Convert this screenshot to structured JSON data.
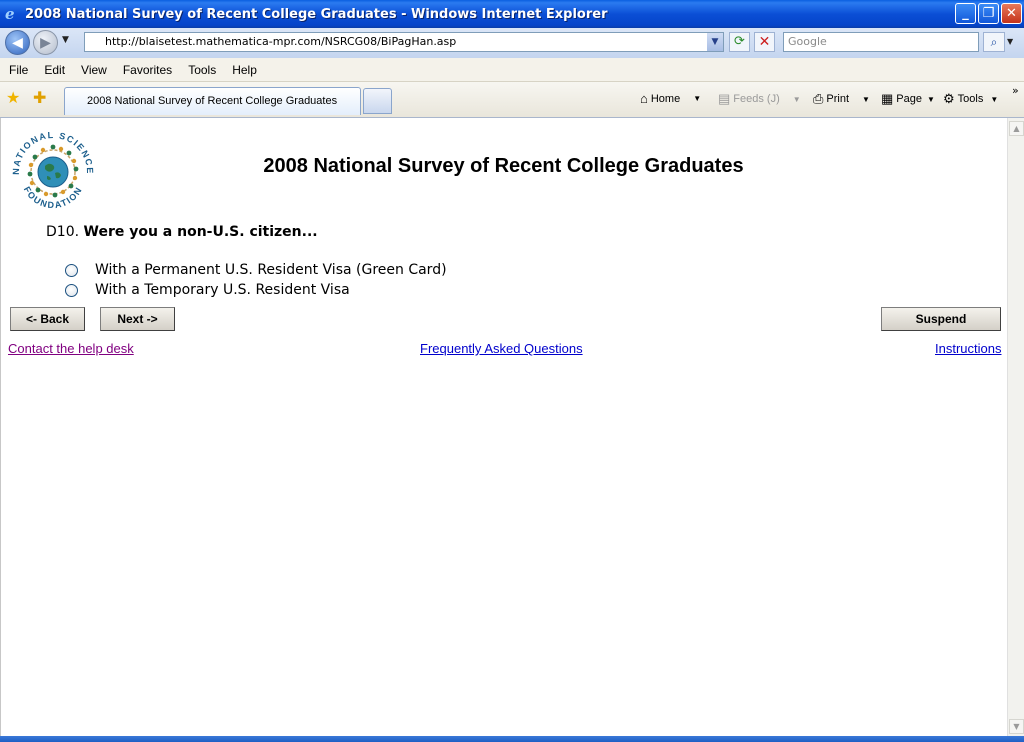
{
  "window": {
    "title": "2008 National Survey of Recent College Graduates - Windows Internet Explorer",
    "icon": "ie-logo-icon"
  },
  "address_bar": {
    "url": "http://blaisetest.mathematica-mpr.com/NSRCG08/BiPagHan.asp",
    "search_placeholder": "Google"
  },
  "menu": {
    "items": [
      "File",
      "Edit",
      "View",
      "Favorites",
      "Tools",
      "Help"
    ]
  },
  "tabs": {
    "active_label": "2008 National Survey of Recent College Graduates"
  },
  "command_bar": {
    "home": "Home",
    "feeds": "Feeds (J)",
    "print": "Print",
    "page": "Page",
    "tools": "Tools"
  },
  "page": {
    "title": "2008 National Survey of Recent College Graduates",
    "logo_text_top": "NATIONAL SCIENCE",
    "logo_text_bottom": "FOUNDATION",
    "question_number": "D10.",
    "question_text": "Were you a non-U.S. citizen...",
    "options": [
      "With a Permanent U.S. Resident Visa (Green Card)",
      "With a Temporary U.S. Resident Visa"
    ],
    "buttons": {
      "back": "<- Back",
      "next": "Next ->",
      "suspend": "Suspend"
    },
    "links": {
      "help_desk": "Contact the help desk",
      "faq": "Frequently Asked Questions",
      "instructions": "Instructions"
    }
  },
  "colors": {
    "titlebar": "#0b4fd6",
    "link": "#0000cc",
    "visited_link": "#800080",
    "logo_green": "#2a7a4a",
    "logo_blue": "#1b5e8c"
  }
}
